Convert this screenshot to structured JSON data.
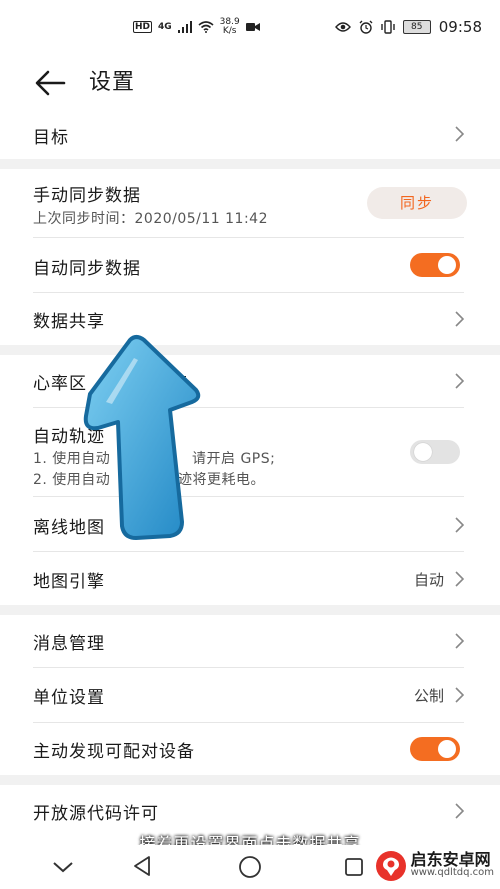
{
  "status_bar": {
    "hd": "HD",
    "network": "4G",
    "speed_value": "38.9",
    "speed_unit": "K/s",
    "battery": "85",
    "time": "09:58"
  },
  "header": {
    "title": "设置"
  },
  "rows": {
    "target": {
      "label": "目标"
    },
    "manual_sync": {
      "label": "手动同步数据",
      "sub": "上次同步时间：2020/05/11 11:42",
      "button": "同步"
    },
    "auto_sync": {
      "label": "自动同步数据",
      "toggle_on": true
    },
    "data_share": {
      "label": "数据共享"
    },
    "heart_rate": {
      "label_start": "心率区",
      "label_end": "管"
    },
    "auto_track": {
      "label": "自动轨迹",
      "line1_start": "1. 使用自动",
      "line1_end": "请开启 GPS;",
      "line2_start": "2. 使用自动",
      "line2_end": "迹将更耗电。",
      "toggle_on": false
    },
    "offline_map": {
      "label": "离线地图"
    },
    "map_engine": {
      "label": "地图引擎",
      "value": "自动"
    },
    "message_mgmt": {
      "label": "消息管理"
    },
    "unit_settings": {
      "label": "单位设置",
      "value": "公制"
    },
    "discover_devices": {
      "label": "主动发现可配对设备",
      "toggle_on": true
    },
    "open_source": {
      "label": "开放源代码许可"
    }
  },
  "caption": "接着再设置界面点击数据共享",
  "watermark": {
    "main": "启东安卓网",
    "sub": "www.qdltdq.com"
  },
  "colors": {
    "accent": "#f46d21",
    "sync_text": "#f2661f",
    "overlay_arrow": "#3aa3d6"
  }
}
